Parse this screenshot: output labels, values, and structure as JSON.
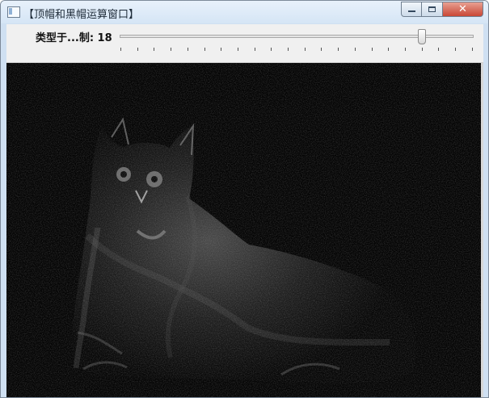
{
  "window": {
    "title": "【顶帽和黑帽运算窗口】",
    "icon_name": "window-app-icon",
    "controls": {
      "minimize": "",
      "maximize": "",
      "close": "✕"
    }
  },
  "trackbar": {
    "label": "类型于...制: 18",
    "value": 18,
    "tick_count": 22
  },
  "image": {
    "description_icon": "cat-image"
  },
  "colors": {
    "titlebar": "#dbe7f5",
    "close": "#c94735",
    "image_bg": "#050505"
  }
}
